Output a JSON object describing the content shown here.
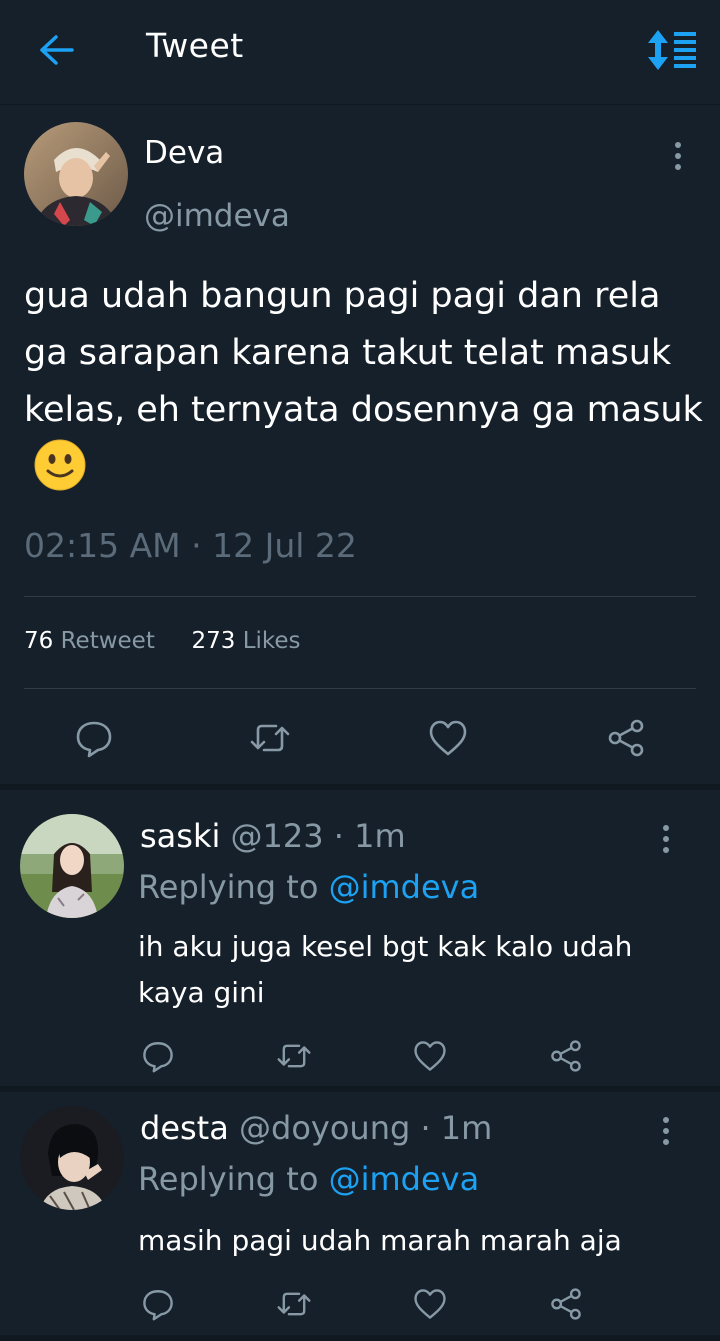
{
  "header": {
    "title": "Tweet",
    "back_icon": "arrow-left-icon",
    "sort_icon": "sort-icon"
  },
  "tweet": {
    "author_name": "Deva",
    "author_handle": "@imdeva",
    "text": "gua udah bangun pagi pagi dan rela ga sarapan karena takut telat masuk kelas, eh ternyata dosennya ga masuk",
    "emoji": "slightly-smiling-face",
    "timestamp": "02:15 AM · 12 Jul 22",
    "retweet_count": "76",
    "retweet_label": "Retweet",
    "likes_count": "273",
    "likes_label": "Likes"
  },
  "replies": [
    {
      "name": "saski",
      "meta": "@123 · 1m",
      "replying_prefix": "Replying to",
      "replying_handle": "@imdeva",
      "text_line1": "ih aku juga kesel bgt kak kalo udah",
      "text_line2": "kaya gini"
    },
    {
      "name": "desta",
      "meta": "@doyoung · 1m",
      "replying_prefix": "Replying to",
      "replying_handle": "@imdeva",
      "text_line1": "masih pagi udah marah marah aja"
    }
  ],
  "colors": {
    "background": "#15202b",
    "accent": "#1da1f2",
    "muted": "#8899a6",
    "divider": "#2f3b47"
  }
}
